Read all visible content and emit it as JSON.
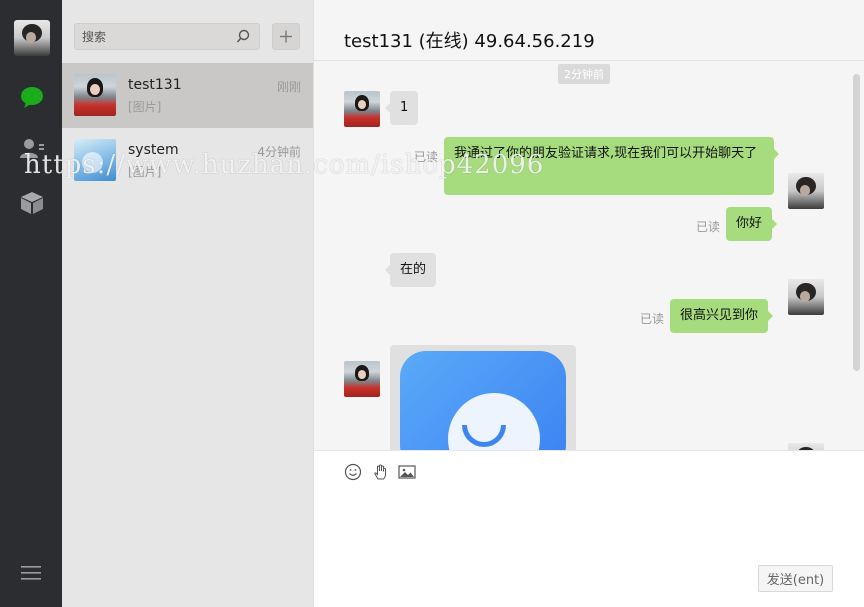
{
  "search": {
    "placeholder": "搜索"
  },
  "add_label": "+",
  "conversations": [
    {
      "name": "test131",
      "preview": "[图片]",
      "time": "刚刚"
    },
    {
      "name": "system",
      "preview": "[图片]",
      "time": "4分钟前"
    }
  ],
  "chat": {
    "title": "test131 (在线) 49.64.56.219",
    "timestamp": "2分钟前",
    "messages": [
      {
        "dir": "in",
        "text": "1"
      },
      {
        "dir": "out",
        "text": "我通过了你的朋友验证请求,现在我们可以开始聊天了",
        "status": "已读"
      },
      {
        "dir": "out",
        "text": "你好",
        "status": "已读"
      },
      {
        "dir": "in",
        "text": "在的"
      },
      {
        "dir": "out",
        "text": "很高兴见到你",
        "status": "已读"
      },
      {
        "dir": "in",
        "type": "image"
      }
    ]
  },
  "composer": {
    "send_label": "发送(ent)"
  },
  "watermark": "https://www.huzhan.com/ishop42096",
  "icons": {
    "nav_chat": "chat-icon",
    "nav_contacts": "contacts-icon",
    "nav_box": "box-icon",
    "nav_menu": "menu-icon",
    "search": "search-icon",
    "emoji": "emoji-icon",
    "shake": "hand-icon",
    "image": "image-icon"
  },
  "colors": {
    "nav_bg": "#2c2d30",
    "active_icon": "#1aad19",
    "out_bubble": "#a6dc7e",
    "in_bubble": "#e0e0e0"
  }
}
